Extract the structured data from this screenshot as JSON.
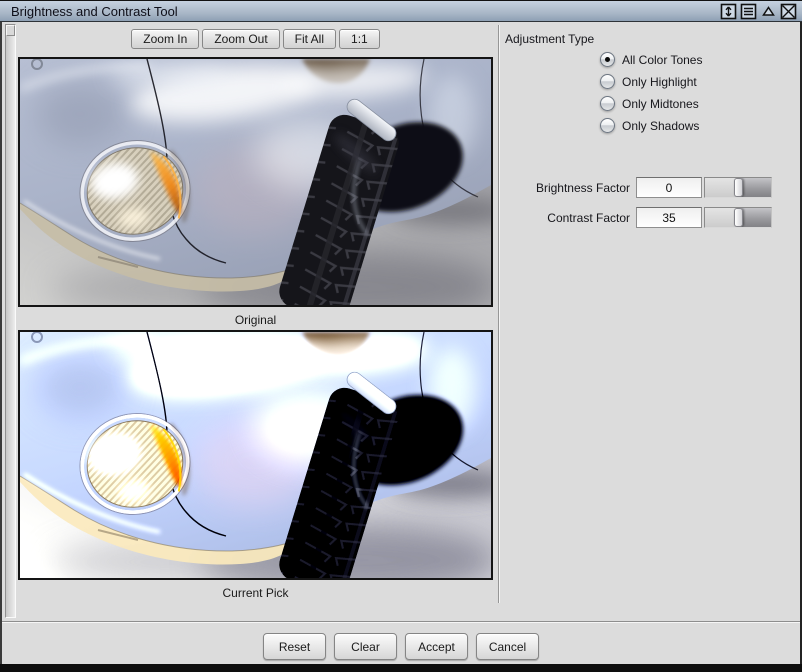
{
  "window": {
    "title": "Brightness and Contrast Tool",
    "control_icons": [
      "resize-vertical-icon",
      "window-menu-icon",
      "shade-triangle-icon",
      "close-icon"
    ]
  },
  "toolbar": {
    "buttons": [
      "Zoom In",
      "Zoom Out",
      "Fit All",
      "1:1"
    ]
  },
  "previews": [
    {
      "caption": "Original"
    },
    {
      "caption": "Current Pick"
    }
  ],
  "adjustment": {
    "heading": "Adjustment Type",
    "options": [
      {
        "label": "All Color Tones",
        "selected": true
      },
      {
        "label": "Only Highlight",
        "selected": false
      },
      {
        "label": "Only Midtones",
        "selected": false
      },
      {
        "label": "Only Shadows",
        "selected": false
      }
    ]
  },
  "factors": {
    "brightness": {
      "label": "Brightness Factor",
      "value": "0",
      "handle_percent": 44
    },
    "contrast": {
      "label": "Contrast Factor",
      "value": "35",
      "handle_percent": 44
    }
  },
  "footer": {
    "buttons": [
      "Reset",
      "Clear",
      "Accept",
      "Cancel"
    ]
  },
  "colors": {
    "titlebar_top": "#c6d2e0",
    "titlebar_bottom": "#8ea0b4",
    "panel_bg": "#dcdcdc",
    "frame_border": "#141414",
    "amber_highlight": "#f08818"
  }
}
